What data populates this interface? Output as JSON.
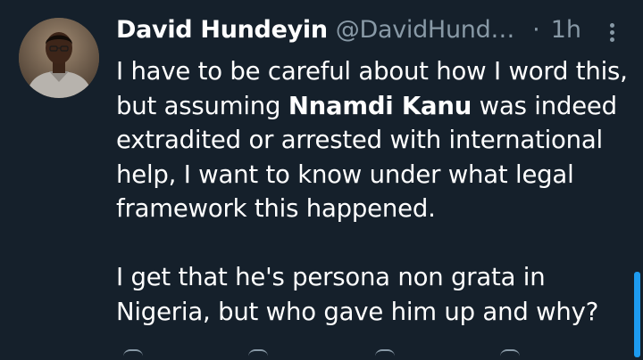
{
  "tweet": {
    "author_name": "David Hundeyin",
    "author_handle": "@DavidHund…",
    "separator": "·",
    "timestamp": "1h",
    "body": {
      "p1_before_mention": "I have to be careful about how I word this, but assuming ",
      "mention": "Nnamdi Kanu",
      "p1_after_mention": " was indeed extradited or arrested with international help, I want to know under what legal framework this happened.",
      "p2": "I get that he's persona non grata in Nigeria, but who gave him up and why?"
    }
  },
  "colors": {
    "background": "#15202b",
    "text": "#ffffff",
    "muted": "#8899a6",
    "accent": "#1d9bf0"
  },
  "icons": {
    "more": "more-vertical-icon",
    "reply": "reply-icon",
    "retweet": "retweet-icon",
    "like": "like-icon",
    "share": "share-icon"
  }
}
